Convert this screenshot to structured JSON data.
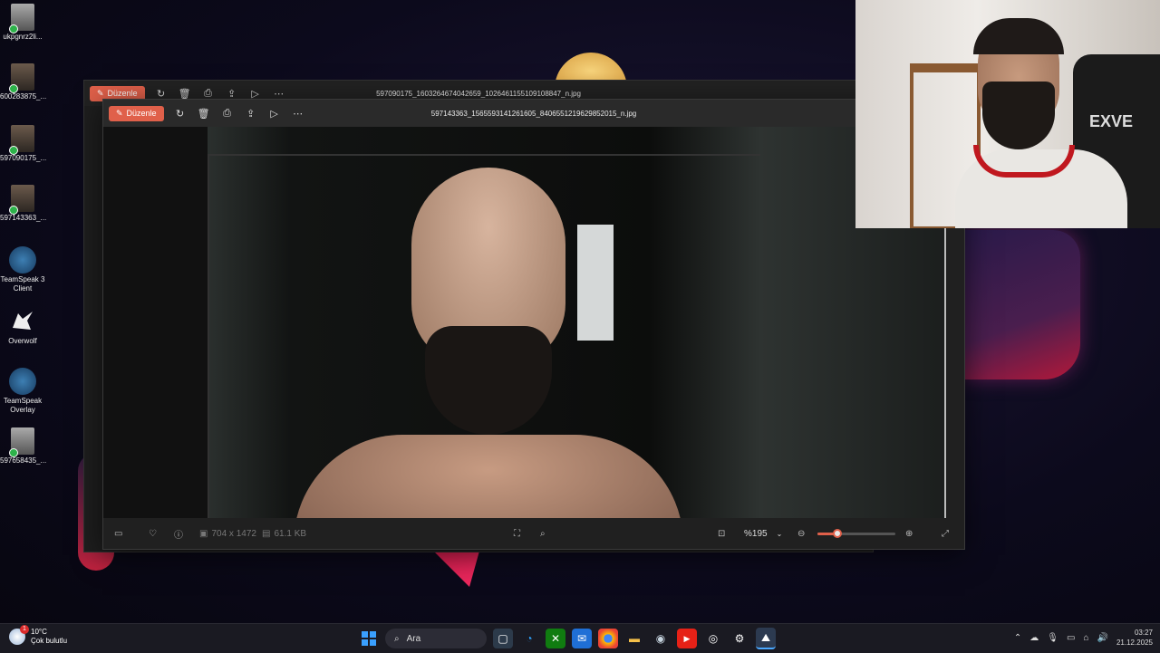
{
  "desktop": {
    "icons": [
      {
        "label": "ukpgnrz2li...",
        "icon": "photo-file-icon"
      },
      {
        "label": "600283875_...",
        "icon": "photo-file-icon"
      },
      {
        "label": "597090175_...",
        "icon": "photo-file-icon"
      },
      {
        "label": "597143363_...",
        "icon": "photo-file-icon"
      },
      {
        "label": "TeamSpeak 3 Client",
        "icon": "teamspeak-icon"
      },
      {
        "label": "Overwolf",
        "icon": "overwolf-icon"
      },
      {
        "label": "TeamSpeak Overlay",
        "icon": "teamspeak-overlay-icon"
      },
      {
        "label": "597658435_...",
        "icon": "photo-file-icon"
      }
    ]
  },
  "back_window": {
    "edit_label": "Düzenle",
    "filename": "597090175_1603264674042659_1026461155109108847_n.jpg"
  },
  "front_window": {
    "edit_label": "Düzenle",
    "filename": "597143363_1565593141261605_8406551219629852015_n.jpg",
    "toolbar_icons": [
      "rotate-icon",
      "delete-icon",
      "print-icon",
      "share-icon",
      "slideshow-icon",
      "more-icon"
    ],
    "app_icons": [
      "copilot-icon",
      "paint-icon",
      "clipchamp-icon",
      "designer-icon",
      "onedrive-icon"
    ],
    "status": {
      "dimensions": "704 x 1472",
      "filesize": "61.1 KB",
      "zoom": "%195",
      "zoom_slider_fraction": 0.25
    }
  },
  "taskbar": {
    "weather_temp": "10°C",
    "weather_desc": "Çok bulutlu",
    "weather_badge": "1",
    "search_placeholder": "Ara",
    "clock_time": "03:27",
    "clock_date": "21.12.2025"
  },
  "colors": {
    "accent": "#e0604a",
    "taskbar": "#1a1a22"
  }
}
